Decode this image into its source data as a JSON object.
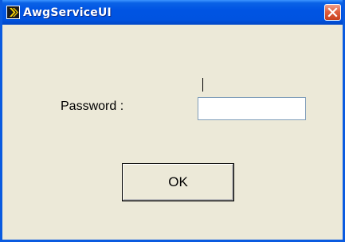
{
  "window": {
    "title": "AwgServiceUI",
    "app_icon": "app-arrow-icon",
    "close_icon": "close-icon"
  },
  "form": {
    "password_label": "Password :",
    "password_value": "",
    "ok_label": "OK"
  },
  "colors": {
    "titlebar": "#0054e3",
    "window_background": "#ece9d8",
    "close_button": "#e0603e",
    "border": "#0a5be0"
  }
}
